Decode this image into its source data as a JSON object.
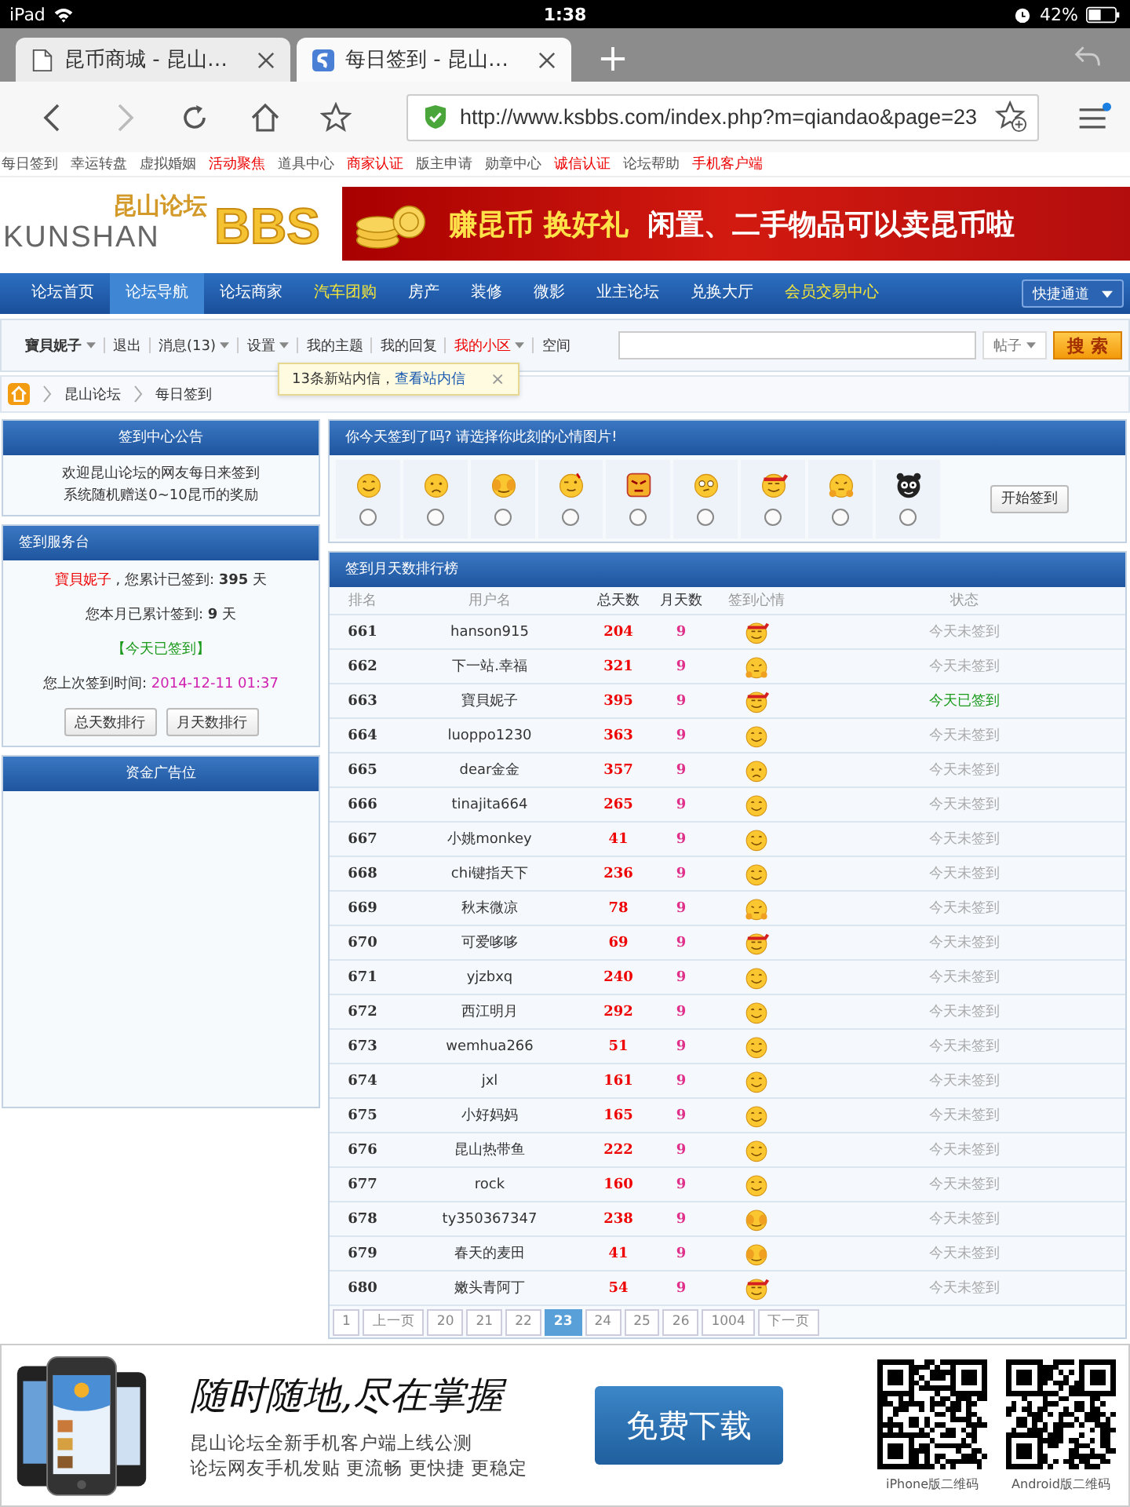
{
  "status_bar": {
    "device": "iPad",
    "time": "1:38",
    "battery": "42%"
  },
  "browser_tabs": [
    {
      "title": "昆币商城 - 昆山…",
      "selected": false
    },
    {
      "title": "每日签到 - 昆山…",
      "selected": true
    }
  ],
  "address_bar": {
    "url": "http://www.ksbbs.com/index.php?m=qiandao&page=23"
  },
  "link_bar": [
    {
      "label": "每日签到",
      "highlighted": false
    },
    {
      "label": "幸运转盘",
      "highlighted": false
    },
    {
      "label": "虚拟婚姻",
      "highlighted": false
    },
    {
      "label": "活动聚焦",
      "highlighted": true
    },
    {
      "label": "道具中心",
      "highlighted": false
    },
    {
      "label": "商家认证",
      "highlighted": true
    },
    {
      "label": "版主申请",
      "highlighted": false
    },
    {
      "label": "勋章中心",
      "highlighted": false
    },
    {
      "label": "诚信认证",
      "highlighted": true
    },
    {
      "label": "论坛帮助",
      "highlighted": false
    },
    {
      "label": "手机客户端",
      "highlighted": true
    }
  ],
  "logo": {
    "chinese": "昆山论坛",
    "latin": "KUNSHAN",
    "bbs": "BBS"
  },
  "ad_banner": {
    "left": "赚昆币 换好礼",
    "right": "闲置、二手物品可以卖昆币啦"
  },
  "nav": [
    {
      "label": "论坛首页",
      "selected": false,
      "highlighted": false
    },
    {
      "label": "论坛导航",
      "selected": true,
      "highlighted": false
    },
    {
      "label": "论坛商家",
      "selected": false,
      "highlighted": false
    },
    {
      "label": "汽车团购",
      "selected": false,
      "highlighted": true
    },
    {
      "label": "房产",
      "selected": false,
      "highlighted": false
    },
    {
      "label": "装修",
      "selected": false,
      "highlighted": false
    },
    {
      "label": "微影",
      "selected": false,
      "highlighted": false
    },
    {
      "label": "业主论坛",
      "selected": false,
      "highlighted": false
    },
    {
      "label": "兑换大厅",
      "selected": false,
      "highlighted": false
    },
    {
      "label": "会员交易中心",
      "selected": false,
      "highlighted": true
    }
  ],
  "quick_access": "快捷通道",
  "user_bar": [
    {
      "label": "寶貝妮子",
      "dropdown": true,
      "highlighted": false,
      "bold": true
    },
    {
      "label": "退出",
      "dropdown": false,
      "highlighted": false,
      "bold": false
    },
    {
      "label": "消息(13)",
      "dropdown": true,
      "highlighted": false,
      "bold": false
    },
    {
      "label": "设置",
      "dropdown": true,
      "highlighted": false,
      "bold": false
    },
    {
      "label": "我的主题",
      "dropdown": false,
      "highlighted": false,
      "bold": false
    },
    {
      "label": "我的回复",
      "dropdown": false,
      "highlighted": false,
      "bold": false
    },
    {
      "label": "我的小区",
      "dropdown": true,
      "highlighted": true,
      "bold": false
    },
    {
      "label": "空间",
      "dropdown": false,
      "highlighted": false,
      "bold": false
    }
  ],
  "search": {
    "scope": "帖子",
    "button": "搜 索"
  },
  "tooltip": {
    "text": "13条新站内信，",
    "link": "查看站内信",
    "close": "×"
  },
  "breadcrumb": [
    "昆山论坛",
    "每日签到"
  ],
  "notice_card": {
    "title": "签到中心公告",
    "lines": [
      "欢迎昆山论坛的网友每日来签到",
      "系统随机赠送0~10昆币的奖励"
    ]
  },
  "service_card": {
    "title": "签到服务台",
    "user": "寶貝妮子",
    "total": " , 您累计已签到: **395** 天",
    "month": "您本月已累计签到: **9** 天",
    "today": "【今天已签到】",
    "last_label": "您上次签到时间: ",
    "last_time": "2014-12-11 01:37",
    "buttons": [
      "总天数排行",
      "月天数排行"
    ]
  },
  "ad_card": {
    "title": "资金广告位"
  },
  "mood_panel": {
    "title": "你今天签到了吗? 请选择你此刻的心情图片!",
    "button": "开始签到",
    "moods": [
      {
        "kind": "smile",
        "selected": false
      },
      {
        "kind": "frown",
        "selected": false
      },
      {
        "kind": "cover",
        "selected": false
      },
      {
        "kind": "wink",
        "selected": false
      },
      {
        "kind": "angry",
        "selected": false
      },
      {
        "kind": "cheeky",
        "selected": false
      },
      {
        "kind": "headband",
        "selected": false
      },
      {
        "kind": "fist",
        "selected": false
      },
      {
        "kind": "black",
        "selected": false
      }
    ]
  },
  "ranking": {
    "title": "签到月天数排行榜",
    "columns": [
      "排名",
      "用户名",
      "总天数",
      "月天数",
      "签到心情",
      "状态"
    ],
    "rows": [
      {
        "rank": "661",
        "user": "hanson915",
        "total": "204",
        "month": "9",
        "mood": {
          "kind": "headband"
        },
        "status": "今天未签到",
        "signed": false
      },
      {
        "rank": "662",
        "user": "下一站.幸福",
        "total": "321",
        "month": "9",
        "mood": {
          "kind": "fist"
        },
        "status": "今天未签到",
        "signed": false
      },
      {
        "rank": "663",
        "user": "寶貝妮子",
        "total": "395",
        "month": "9",
        "mood": {
          "kind": "headband"
        },
        "status": "今天已签到",
        "signed": true
      },
      {
        "rank": "664",
        "user": "luoppo1230",
        "total": "363",
        "month": "9",
        "mood": {
          "kind": "smile"
        },
        "status": "今天未签到",
        "signed": false
      },
      {
        "rank": "665",
        "user": "dear金金",
        "total": "357",
        "month": "9",
        "mood": {
          "kind": "frown"
        },
        "status": "今天未签到",
        "signed": false
      },
      {
        "rank": "666",
        "user": "tinajita664",
        "total": "265",
        "month": "9",
        "mood": {
          "kind": "smile"
        },
        "status": "今天未签到",
        "signed": false
      },
      {
        "rank": "667",
        "user": "小姚monkey",
        "total": "41",
        "month": "9",
        "mood": {
          "kind": "smile"
        },
        "status": "今天未签到",
        "signed": false
      },
      {
        "rank": "668",
        "user": "chi键指天下",
        "total": "236",
        "month": "9",
        "mood": {
          "kind": "smile"
        },
        "status": "今天未签到",
        "signed": false
      },
      {
        "rank": "669",
        "user": "秋末微凉",
        "total": "78",
        "month": "9",
        "mood": {
          "kind": "fist"
        },
        "status": "今天未签到",
        "signed": false
      },
      {
        "rank": "670",
        "user": "可爱哆哆",
        "total": "69",
        "month": "9",
        "mood": {
          "kind": "headband"
        },
        "status": "今天未签到",
        "signed": false
      },
      {
        "rank": "671",
        "user": "yjzbxq",
        "total": "240",
        "month": "9",
        "mood": {
          "kind": "smile"
        },
        "status": "今天未签到",
        "signed": false
      },
      {
        "rank": "672",
        "user": "西江明月",
        "total": "292",
        "month": "9",
        "mood": {
          "kind": "smile"
        },
        "status": "今天未签到",
        "signed": false
      },
      {
        "rank": "673",
        "user": "wemhua266",
        "total": "51",
        "month": "9",
        "mood": {
          "kind": "smile"
        },
        "status": "今天未签到",
        "signed": false
      },
      {
        "rank": "674",
        "user": "jxl",
        "total": "161",
        "month": "9",
        "mood": {
          "kind": "smile"
        },
        "status": "今天未签到",
        "signed": false
      },
      {
        "rank": "675",
        "user": "小好妈妈",
        "total": "165",
        "month": "9",
        "mood": {
          "kind": "smile"
        },
        "status": "今天未签到",
        "signed": false
      },
      {
        "rank": "676",
        "user": "昆山热带鱼",
        "total": "222",
        "month": "9",
        "mood": {
          "kind": "smile"
        },
        "status": "今天未签到",
        "signed": false
      },
      {
        "rank": "677",
        "user": "rock",
        "total": "160",
        "month": "9",
        "mood": {
          "kind": "smile"
        },
        "status": "今天未签到",
        "signed": false
      },
      {
        "rank": "678",
        "user": "ty350367347",
        "total": "238",
        "month": "9",
        "mood": {
          "kind": "cover"
        },
        "status": "今天未签到",
        "signed": false
      },
      {
        "rank": "679",
        "user": "春天的麦田",
        "total": "41",
        "month": "9",
        "mood": {
          "kind": "cover"
        },
        "status": "今天未签到",
        "signed": false
      },
      {
        "rank": "680",
        "user": "嫩头青阿丁",
        "total": "54",
        "month": "9",
        "mood": {
          "kind": "headband"
        },
        "status": "今天未签到",
        "signed": false
      }
    ],
    "pager": [
      {
        "label": "1",
        "selected": false
      },
      {
        "label": "上一页",
        "selected": false
      },
      {
        "label": "20",
        "selected": false
      },
      {
        "label": "21",
        "selected": false
      },
      {
        "label": "22",
        "selected": false
      },
      {
        "label": "23",
        "selected": true
      },
      {
        "label": "24",
        "selected": false
      },
      {
        "label": "25",
        "selected": false
      },
      {
        "label": "26",
        "selected": false
      },
      {
        "label": "1004",
        "selected": false
      },
      {
        "label": "下一页",
        "selected": false
      }
    ]
  },
  "app_promo": {
    "slogan": "随时随地,尽在掌握",
    "lines": [
      "昆山论坛全新手机客户端上线公测",
      "论坛网友手机发贴 更流畅 更快捷 更稳定"
    ],
    "button": "免费下载",
    "qr_codes": [
      {
        "caption": "iPhone版二维码"
      },
      {
        "caption": "Android版二维码"
      }
    ]
  }
}
